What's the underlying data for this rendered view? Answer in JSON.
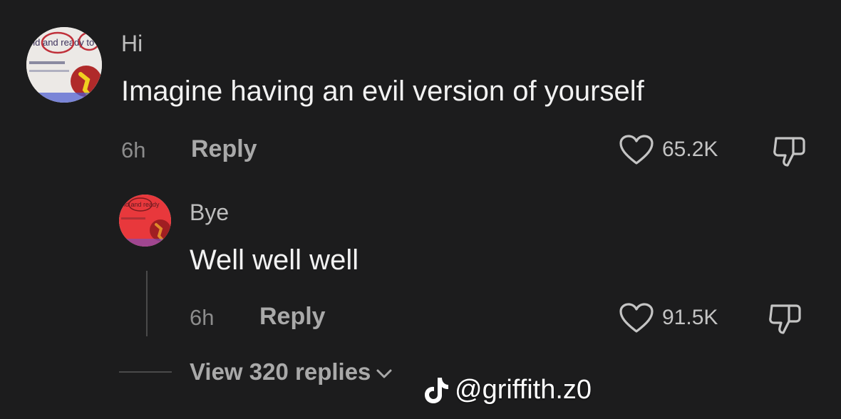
{
  "comments": [
    {
      "username": "Hi",
      "text": "Imagine having an evil version of yourself",
      "time": "6h",
      "reply_label": "Reply",
      "likes": "65.2K",
      "avatar_text": "old and ready to"
    },
    {
      "username": "Bye",
      "text": "Well well well",
      "time": "6h",
      "reply_label": "Reply",
      "likes": "91.5K",
      "avatar_text": "old and ready"
    }
  ],
  "view_replies": {
    "label": "View 320 replies"
  },
  "watermark": {
    "handle": "@griffith.z0"
  },
  "colors": {
    "background": "#1c1c1d",
    "comment_text": "#f2f2f2",
    "meta_text": "#8c8c8c",
    "reply_avatar_tint": "#e8383c"
  },
  "icons": {
    "like": "heart-outline-icon",
    "dislike": "thumbs-down-outline-icon",
    "expand": "chevron-down-icon",
    "brand": "tiktok-icon"
  }
}
